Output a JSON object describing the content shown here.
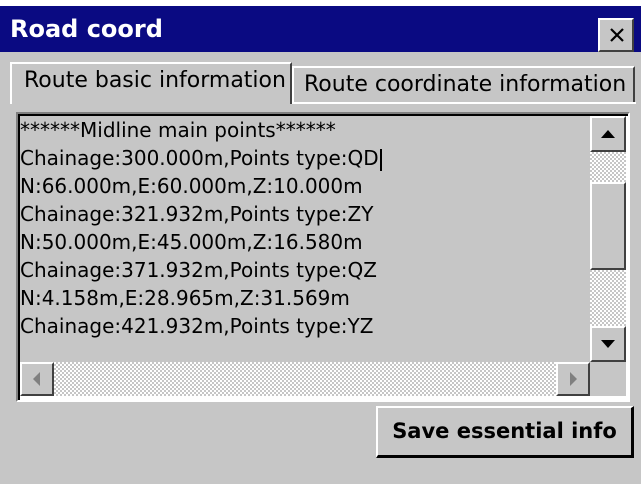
{
  "window": {
    "title": "Road coord",
    "close_symbol": "×"
  },
  "tabs": [
    {
      "label": "Route basic information",
      "active": true
    },
    {
      "label": "Route coordinate information",
      "active": false
    }
  ],
  "content": {
    "lines": [
      "******Midline main points******",
      "Chainage:300.000m,Points type:QD",
      "N:66.000m,E:60.000m,Z:10.000m",
      "Chainage:321.932m,Points type:ZY",
      "N:50.000m,E:45.000m,Z:16.580m",
      "Chainage:371.932m,Points type:QZ",
      "N:4.158m,E:28.965m,Z:31.569m",
      "Chainage:421.932m,Points type:YZ"
    ]
  },
  "buttons": {
    "save_label": "Save essential info"
  },
  "colors": {
    "titlebar": "#0a0a82",
    "face": "#c6c6c6"
  },
  "icons": {
    "close": "close-icon",
    "scroll_up": "arrow-up-icon",
    "scroll_down": "arrow-down-icon",
    "scroll_left": "arrow-left-icon",
    "scroll_right": "arrow-right-icon"
  }
}
